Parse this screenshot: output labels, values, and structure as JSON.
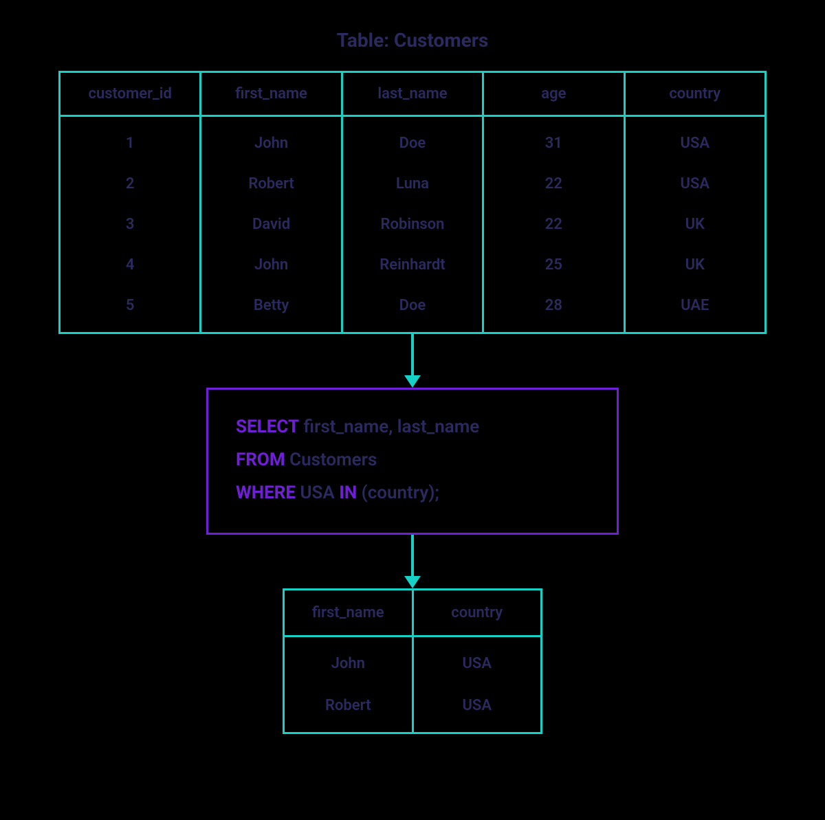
{
  "title": "Table: Customers",
  "source_table": {
    "headers": [
      "customer_id",
      "first_name",
      "last_name",
      "age",
      "country"
    ],
    "rows": [
      [
        "1",
        "John",
        "Doe",
        "31",
        "USA"
      ],
      [
        "2",
        "Robert",
        "Luna",
        "22",
        "USA"
      ],
      [
        "3",
        "David",
        "Robinson",
        "22",
        "UK"
      ],
      [
        "4",
        "John",
        "Reinhardt",
        "25",
        "UK"
      ],
      [
        "5",
        "Betty",
        "Doe",
        "28",
        "UAE"
      ]
    ]
  },
  "sql": {
    "line1": {
      "kw": "SELECT",
      "rest": " first_name, last_name"
    },
    "line2": {
      "kw": "FROM",
      "rest": " Customers"
    },
    "line3": {
      "kw1": "WHERE",
      "mid": " USA ",
      "kw2": "IN",
      "rest": " (country);"
    }
  },
  "result_table": {
    "headers": [
      "first_name",
      "country"
    ],
    "rows": [
      [
        "John",
        "USA"
      ],
      [
        "Robert",
        "USA"
      ]
    ]
  },
  "chart_data": {
    "type": "table",
    "title": "SQL IN operator example over Customers table",
    "source": {
      "name": "Customers",
      "columns": [
        "customer_id",
        "first_name",
        "last_name",
        "age",
        "country"
      ],
      "rows": [
        [
          1,
          "John",
          "Doe",
          31,
          "USA"
        ],
        [
          2,
          "Robert",
          "Luna",
          22,
          "USA"
        ],
        [
          3,
          "David",
          "Robinson",
          22,
          "UK"
        ],
        [
          4,
          "John",
          "Reinhardt",
          25,
          "UK"
        ],
        [
          5,
          "Betty",
          "Doe",
          28,
          "UAE"
        ]
      ]
    },
    "query": "SELECT first_name, last_name FROM Customers WHERE USA IN (country);",
    "result": {
      "columns": [
        "first_name",
        "country"
      ],
      "rows": [
        [
          "John",
          "USA"
        ],
        [
          "Robert",
          "USA"
        ]
      ]
    }
  }
}
